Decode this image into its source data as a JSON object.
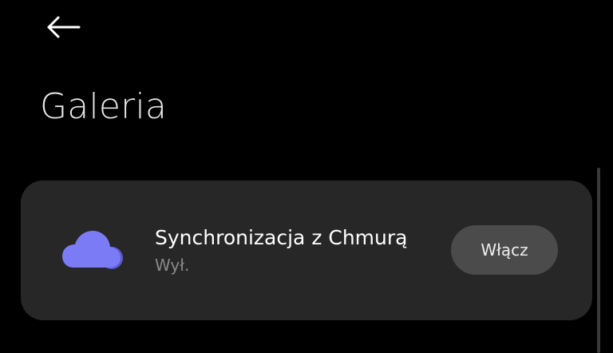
{
  "header": {
    "back_icon": "arrow-left-icon",
    "title": "Galeria"
  },
  "card": {
    "icon": "cloud-icon",
    "icon_color": "#7b7bf5",
    "title": "Synchronizacja z Chmurą",
    "status": "Wył.",
    "button_label": "Włącz"
  },
  "colors": {
    "background": "#000000",
    "card": "#272727",
    "button": "#4b4b4b",
    "status_text": "#8a8a8a"
  }
}
